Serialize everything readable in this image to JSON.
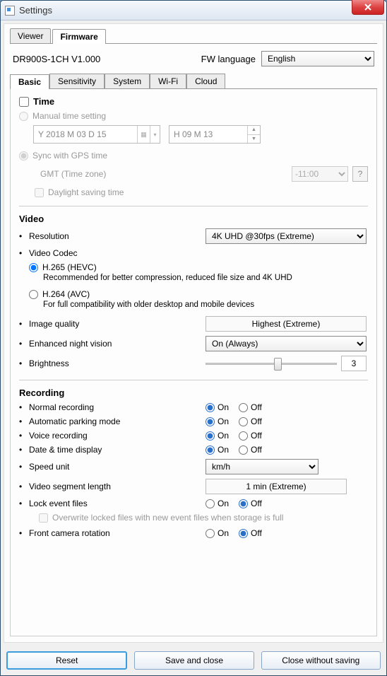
{
  "window": {
    "title": "Settings"
  },
  "top_tabs": {
    "viewer": "Viewer",
    "firmware": "Firmware"
  },
  "model": "DR900S-1CH   V1.000",
  "fw_language_label": "FW language",
  "fw_language": "English",
  "sub_tabs": {
    "basic": "Basic",
    "sensitivity": "Sensitivity",
    "system": "System",
    "wifi": "Wi-Fi",
    "cloud": "Cloud"
  },
  "time": {
    "heading": "Time",
    "manual": "Manual time setting",
    "date": "Y 2018 M 03 D 15",
    "hm": "H 09 M 13",
    "sync": "Sync with GPS time",
    "gmt_label": "GMT (Time zone)",
    "gmt_value": "-11:00",
    "q": "?",
    "dst": "Daylight saving time"
  },
  "video": {
    "heading": "Video",
    "resolution_label": "Resolution",
    "resolution": "4K UHD @30fps (Extreme)",
    "codec_label": "Video Codec",
    "h265": "H.265 (HEVC)",
    "h265_desc": "Recommended for better compression, reduced file size and 4K UHD",
    "h264": "H.264 (AVC)",
    "h264_desc": "For full compatibility with older desktop and mobile devices",
    "image_quality_label": "Image quality",
    "image_quality": "Highest (Extreme)",
    "night_label": "Enhanced night vision",
    "night": "On (Always)",
    "brightness_label": "Brightness",
    "brightness": "3"
  },
  "recording": {
    "heading": "Recording",
    "normal": "Normal recording",
    "parking": "Automatic parking mode",
    "voice": "Voice recording",
    "datetime": "Date & time display",
    "speed_label": "Speed unit",
    "speed": "km/h",
    "segment_label": "Video segment length",
    "segment": "1 min (Extreme)",
    "lock_label": "Lock event files",
    "overwrite": "Overwrite locked files with new event files when storage is full",
    "rotation": "Front camera rotation",
    "on": "On",
    "off": "Off"
  },
  "buttons": {
    "reset": "Reset",
    "save": "Save and close",
    "close": "Close without saving"
  }
}
